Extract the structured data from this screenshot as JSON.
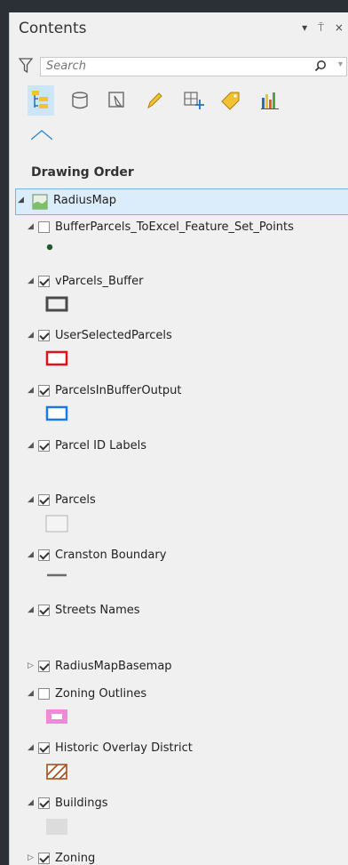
{
  "pane": {
    "title": "Contents",
    "title_icons": "▾ ⍑ ×",
    "search_placeholder": "Search"
  },
  "section_title": "Drawing Order",
  "map": {
    "name": "RadiusMap"
  },
  "layers": [
    {
      "label": "BufferParcels_ToExcel_Feature_Set_Points",
      "checked": false,
      "expand": "◢",
      "symbol": "point-dark-green"
    },
    {
      "label": "vParcels_Buffer",
      "checked": true,
      "expand": "◢",
      "symbol": "rect-dark-gray-outline"
    },
    {
      "label": "UserSelectedParcels",
      "checked": true,
      "expand": "◢",
      "symbol": "rect-red-outline"
    },
    {
      "label": "ParcelsInBufferOutput",
      "checked": true,
      "expand": "◢",
      "symbol": "rect-blue-outline"
    },
    {
      "label": "Parcel ID Labels",
      "checked": true,
      "expand": "◢",
      "symbol": "none"
    },
    {
      "label": "Parcels",
      "checked": true,
      "expand": "◢",
      "symbol": "rect-light-gray"
    },
    {
      "label": "Cranston Boundary",
      "checked": true,
      "expand": "◢",
      "symbol": "line-gray"
    },
    {
      "label": "Streets Names",
      "checked": true,
      "expand": "◢",
      "symbol": "none"
    },
    {
      "label": "RadiusMapBasemap",
      "checked": true,
      "expand": "▷",
      "symbol": "none"
    },
    {
      "label": "Zoning Outlines",
      "checked": false,
      "expand": "◢",
      "symbol": "rect-pink"
    },
    {
      "label": "Historic Overlay District",
      "checked": true,
      "expand": "◢",
      "symbol": "rect-hatched-brown"
    },
    {
      "label": "Buildings",
      "checked": true,
      "expand": "◢",
      "symbol": "rect-gray-fill"
    },
    {
      "label": "Zoning",
      "checked": true,
      "expand": "▷",
      "symbol": "none"
    }
  ],
  "colors": {
    "point": "#1f5a2e",
    "dark_outline": "#4a4a4a",
    "red_outline": "#e0121c",
    "blue_outline": "#1a7ae6",
    "pink": "#f08ad8",
    "hatch": "#a6501e",
    "building": "#dcdcdc"
  }
}
